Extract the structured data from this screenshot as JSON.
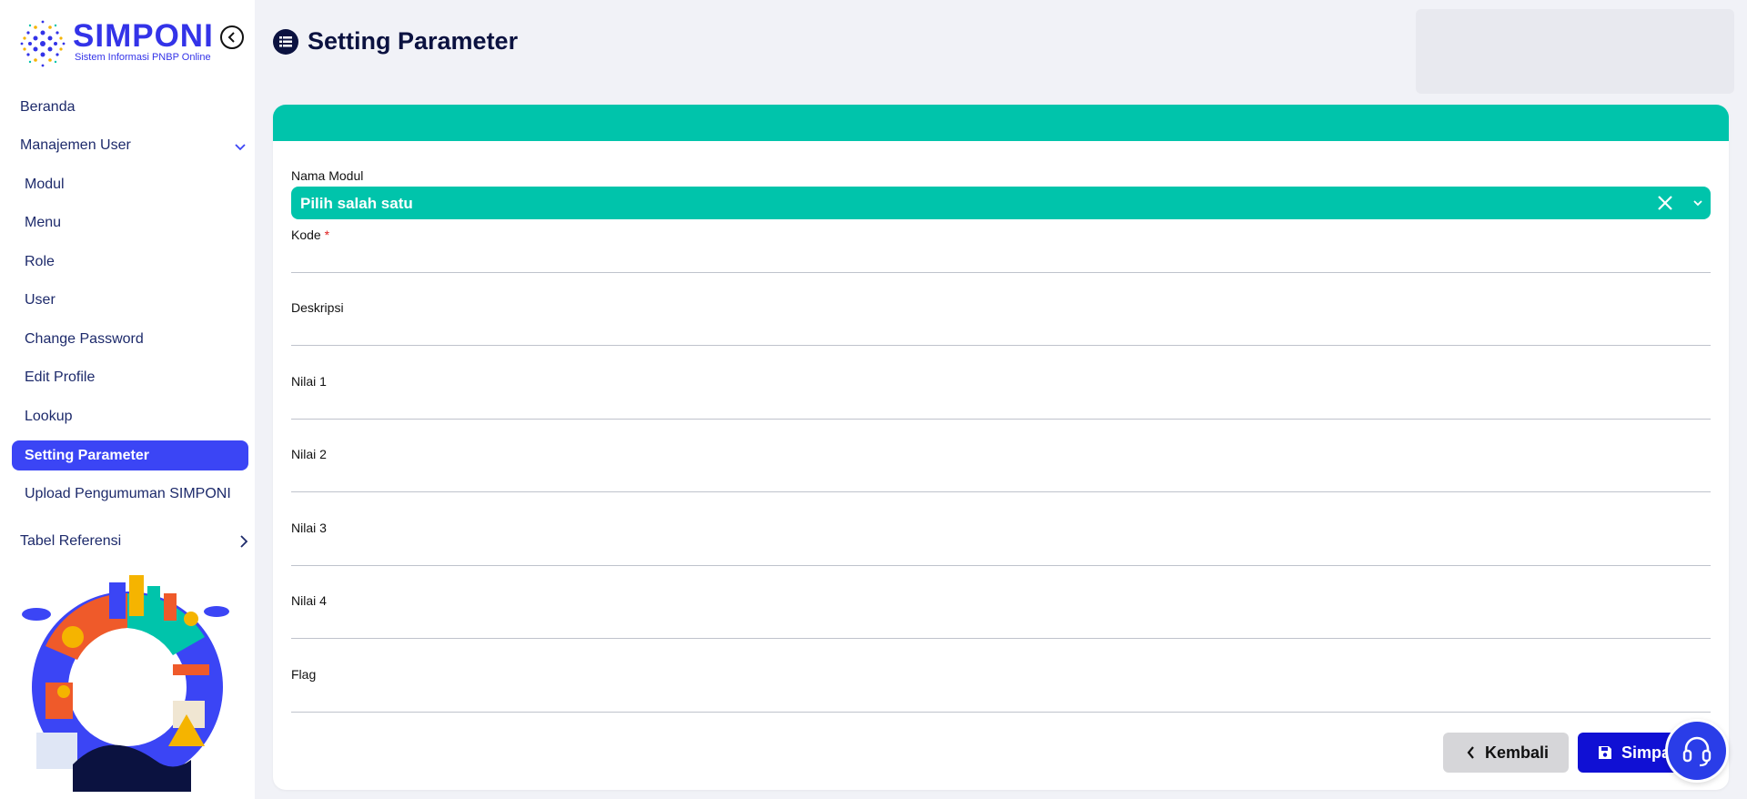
{
  "app": {
    "logo_title": "SIMPONI",
    "logo_subtitle": "Sistem Informasi PNBP Online",
    "brand_color": "#3333e8"
  },
  "sidebar": {
    "items": [
      {
        "label": "Beranda"
      },
      {
        "label": "Manajemen User",
        "expanded": true
      },
      {
        "label": "Modul"
      },
      {
        "label": "Menu"
      },
      {
        "label": "Role"
      },
      {
        "label": "User"
      },
      {
        "label": "Change Password"
      },
      {
        "label": "Edit Profile"
      },
      {
        "label": "Lookup"
      },
      {
        "label": "Setting Parameter",
        "active": true
      },
      {
        "label": "Upload Pengumuman SIMPONI"
      },
      {
        "label": "Tabel Referensi",
        "expanded": false
      }
    ],
    "active_color": "#3b45f5"
  },
  "header": {
    "title": "Setting Parameter",
    "icon": "list-icon"
  },
  "form": {
    "accent_color": "#00c4ab",
    "nama_modul": {
      "label": "Nama Modul",
      "value": "Pilih salah satu"
    },
    "kode": {
      "label": "Kode",
      "required_mark": "*",
      "value": ""
    },
    "deskripsi": {
      "label": "Deskripsi",
      "value": ""
    },
    "nilai1": {
      "label": "Nilai 1",
      "value": ""
    },
    "nilai2": {
      "label": "Nilai 2",
      "value": ""
    },
    "nilai3": {
      "label": "Nilai 3",
      "value": ""
    },
    "nilai4": {
      "label": "Nilai 4",
      "value": ""
    },
    "flag": {
      "label": "Flag",
      "value": ""
    }
  },
  "actions": {
    "back_label": "Kembali",
    "save_label": "Simpan"
  }
}
